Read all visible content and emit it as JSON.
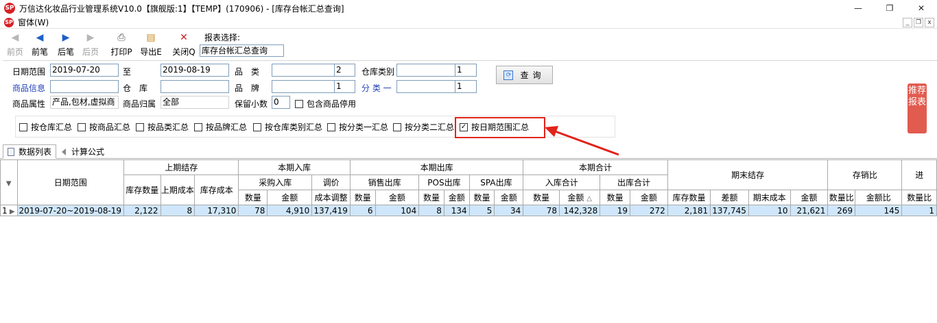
{
  "window": {
    "title": "万信达化妆品行业管理系统V10.0【旗舰版:1】【TEMP】(170906) - [库存台帐汇总查询]",
    "logo_text": "SP",
    "minimize": "—",
    "maximize": "❐",
    "close": "✕"
  },
  "menubar": {
    "logo_text": "SP",
    "item": "窗体(W)",
    "mdi_min": "_",
    "mdi_restore": "❐",
    "mdi_close": "x"
  },
  "toolbar": {
    "prev_page": "前页",
    "prev_record": "前笔",
    "next_record": "后笔",
    "next_page": "后页",
    "print": "打印P",
    "export": "导出E",
    "close": "关闭Q",
    "report_select_label": "报表选择:",
    "report_select_value": "库存台帐汇总查询"
  },
  "filters": {
    "date_range_label": "日期范围",
    "date_from": "2019-07-20",
    "to_label": "至",
    "date_to": "2019-08-19",
    "category_label": "品　类",
    "category_value": "",
    "category_level": "2",
    "warehouse_type_label": "仓库类别",
    "warehouse_type_value": "",
    "warehouse_type_level": "1",
    "product_info_label": "商品信息",
    "product_info_value": "",
    "warehouse_label": "仓　库",
    "warehouse_value": "",
    "brand_label": "品　牌",
    "brand_value": "",
    "brand_level": "1",
    "class1_label": "分 类 一",
    "class1_value": "",
    "class1_level": "1",
    "product_attr_label": "商品属性",
    "product_attr_value": "产品,包材,虚拟商",
    "product_owner_label": "商品归属",
    "product_owner_value": "全部",
    "decimals_label": "保留小数",
    "decimals_value": "0",
    "include_disabled_label": "包含商品停用",
    "query_button": "查询"
  },
  "group_options": [
    {
      "label": "按仓库汇总",
      "checked": false
    },
    {
      "label": "按商品汇总",
      "checked": false
    },
    {
      "label": "按品类汇总",
      "checked": false
    },
    {
      "label": "按品牌汇总",
      "checked": false
    },
    {
      "label": "按仓库类别汇总",
      "checked": false
    },
    {
      "label": "按分类一汇总",
      "checked": false
    },
    {
      "label": "按分类二汇总",
      "checked": false
    },
    {
      "label": "按日期范围汇总",
      "checked": true
    }
  ],
  "side_panel": "推荐报表",
  "tabs": [
    {
      "label": "数据列表",
      "active": true
    },
    {
      "label": "计算公式",
      "active": false
    }
  ],
  "grid": {
    "group_headers": {
      "date_range": "日期范围",
      "prev_stock": "上期结存",
      "period_in": "本期入库",
      "period_out": "本期出库",
      "period_total": "本期合计",
      "period_end": "期末结存",
      "stock_sales_ratio": "存销比",
      "next": "进"
    },
    "sub_headers": {
      "purchase_in": "采购入库",
      "price_adjust": "调价",
      "sales_out": "销售出库",
      "pos_out": "POS出库",
      "spa_out": "SPA出库",
      "in_total": "入库合计",
      "out_total": "出库合计"
    },
    "leaf_headers": {
      "prev_qty": "库存数量",
      "prev_unit_cost": "上期成本",
      "prev_cost": "库存成本",
      "pin_qty": "数量",
      "pin_amt": "金额",
      "cost_adjust": "成本调整",
      "sale_qty": "数量",
      "sale_amt": "金额",
      "pos_qty": "数量",
      "pos_amt": "金额",
      "spa_qty": "数量",
      "spa_amt": "金额",
      "intot_qty": "数量",
      "intot_amt": "金额",
      "outtot_qty": "数量",
      "outtot_amt": "金额",
      "end_stock_qty": "库存数量",
      "end_diff": "差额",
      "end_unit_cost": "期末成本",
      "end_amt": "金额",
      "ratio_qty": "数量比",
      "ratio_amt": "金额比",
      "next_qty": "数量比"
    },
    "rows": [
      {
        "row_no": "1",
        "date_range": "2019-07-20~2019-08-19",
        "prev_qty": "2,122",
        "prev_unit_cost": "8",
        "prev_cost": "17,310",
        "pin_qty": "78",
        "pin_amt": "4,910",
        "cost_adjust": "137,419",
        "sale_qty": "6",
        "sale_amt": "104",
        "pos_qty": "8",
        "pos_amt": "134",
        "spa_qty": "5",
        "spa_amt": "34",
        "intot_qty": "78",
        "intot_amt": "142,328",
        "outtot_qty": "19",
        "outtot_amt": "272",
        "end_stock_qty": "2,181",
        "end_diff": "137,745",
        "end_unit_cost": "10",
        "end_amt": "21,621",
        "ratio_qty": "269",
        "ratio_amt": "145",
        "next_qty": "1"
      }
    ]
  },
  "colors": {
    "selected_row": "#cfe6fb",
    "highlight": "#e2231a",
    "side_panel": "#e25b4f",
    "blue_label": "#1f3fb8"
  }
}
